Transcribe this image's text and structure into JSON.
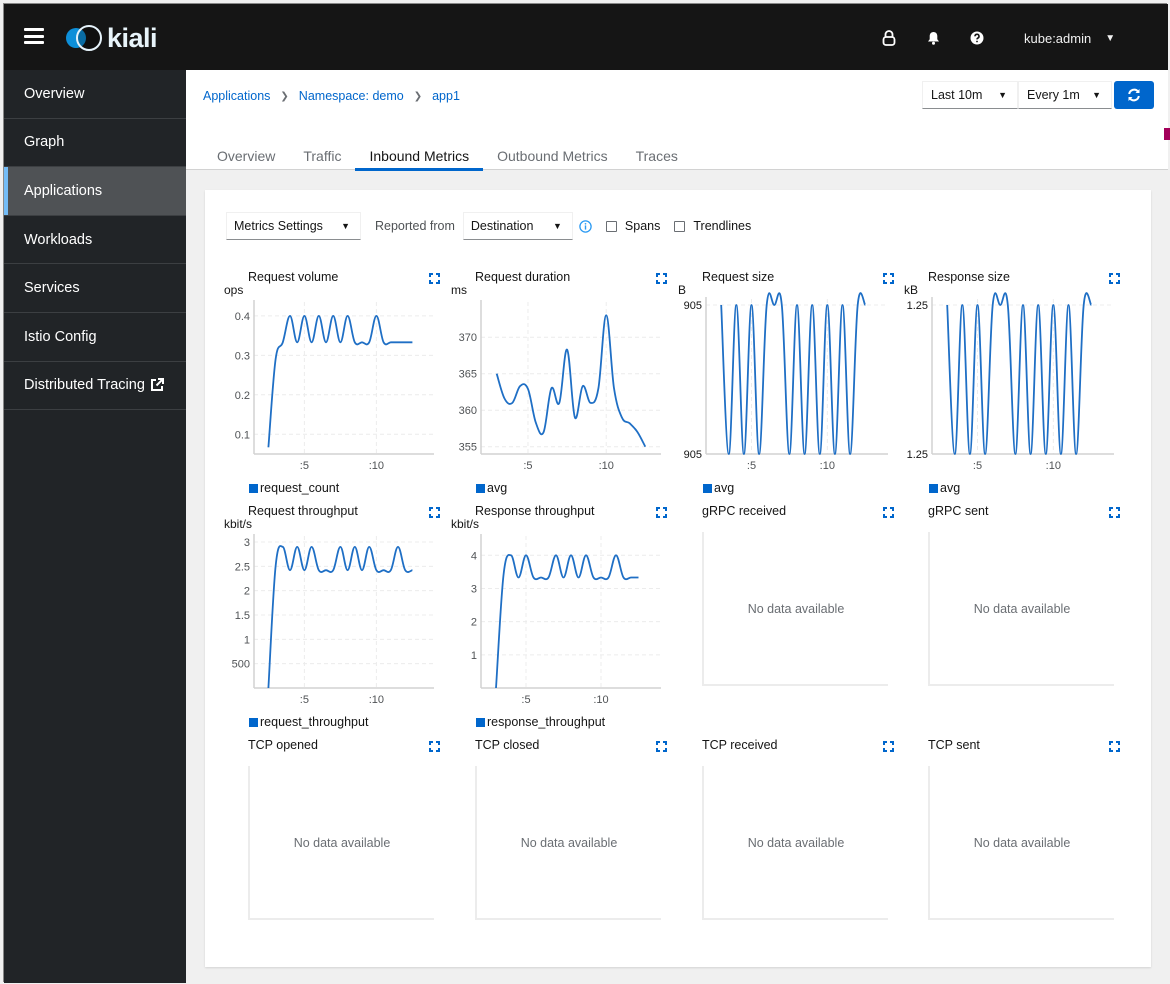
{
  "topbar": {
    "brand": "kiali",
    "icons": [
      "lock-icon",
      "bell-icon",
      "help-icon"
    ],
    "user": "kube:admin"
  },
  "sidebar": {
    "items": [
      {
        "label": "Overview",
        "active": false
      },
      {
        "label": "Graph",
        "active": false
      },
      {
        "label": "Applications",
        "active": true
      },
      {
        "label": "Workloads",
        "active": false
      },
      {
        "label": "Services",
        "active": false
      },
      {
        "label": "Istio Config",
        "active": false
      },
      {
        "label": "Distributed Tracing",
        "active": false,
        "external": true
      }
    ]
  },
  "breadcrumb": [
    "Applications",
    "Namespace: demo",
    "app1"
  ],
  "time_controls": {
    "range": "Last 10m",
    "refresh": "Every 1m"
  },
  "tabs": [
    {
      "label": "Overview",
      "active": false
    },
    {
      "label": "Traffic",
      "active": false
    },
    {
      "label": "Inbound Metrics",
      "active": true
    },
    {
      "label": "Outbound Metrics",
      "active": false
    },
    {
      "label": "Traces",
      "active": false
    }
  ],
  "toolbar": {
    "metrics_settings": "Metrics Settings",
    "reported_from_label": "Reported from",
    "reported_from_value": "Destination",
    "spans_label": "Spans",
    "spans_checked": false,
    "trendlines_label": "Trendlines",
    "trendlines_checked": false
  },
  "colors": {
    "accent": "#0066cc",
    "series": "#1f6fc5",
    "nav_active_bar": "#73bcf7",
    "topbar_bg": "#151515",
    "sidebar_bg": "#212427"
  },
  "no_data_text": "No data available",
  "chart_data": [
    {
      "type": "line",
      "title": "Request volume",
      "ylabel": "ops",
      "legend": [
        "request_count"
      ],
      "xtick_labels": [
        ":5",
        ":10"
      ],
      "xticks": [
        5,
        10
      ],
      "xlim": [
        1.5,
        14
      ],
      "yticks": [
        0.1,
        0.2,
        0.3,
        0.4
      ],
      "ytick_labels": [
        "0.1",
        "0.2",
        "0.3",
        "0.4"
      ],
      "ylim": [
        0.05,
        0.42
      ],
      "x": [
        2.5,
        3,
        3.5,
        4,
        4.5,
        5,
        5.5,
        6,
        6.5,
        7,
        7.5,
        8,
        8.5,
        9,
        9.5,
        10,
        10.5,
        11,
        11.5,
        12,
        12.5
      ],
      "values": [
        0.067,
        0.29,
        0.333,
        0.4,
        0.333,
        0.4,
        0.333,
        0.4,
        0.333,
        0.4,
        0.333,
        0.4,
        0.333,
        0.333,
        0.333,
        0.4,
        0.333,
        0.333,
        0.333,
        0.333,
        0.333
      ]
    },
    {
      "type": "line",
      "title": "Request duration",
      "ylabel": "ms",
      "legend": [
        "avg"
      ],
      "xtick_labels": [
        ":5",
        ":10"
      ],
      "xticks": [
        5,
        10
      ],
      "xlim": [
        2,
        13.5
      ],
      "yticks": [
        355,
        360,
        365,
        370
      ],
      "ytick_labels": [
        "355",
        "360",
        "365",
        "370"
      ],
      "ylim": [
        354,
        374
      ],
      "x": [
        3,
        3.5,
        4,
        4.5,
        5,
        5.5,
        6,
        6.5,
        7,
        7.5,
        8,
        8.5,
        9,
        9.5,
        10,
        10.5,
        11,
        11.5,
        12,
        12.5
      ],
      "values": [
        365,
        361.6,
        361,
        363.3,
        362.9,
        358.3,
        357,
        363,
        361,
        368.3,
        359,
        363.3,
        361,
        363,
        373,
        363,
        359,
        358.2,
        357,
        355
      ]
    },
    {
      "type": "line",
      "title": "Request size",
      "ylabel": "B",
      "legend": [
        "avg"
      ],
      "xtick_labels": [
        ":5",
        ":10"
      ],
      "xticks": [
        5,
        10
      ],
      "xlim": [
        2,
        14
      ],
      "yticks": [
        0,
        1
      ],
      "ytick_labels": [
        "905",
        "905"
      ],
      "ylim": [
        0,
        1
      ],
      "x": [
        3,
        3.5,
        4,
        4.5,
        5,
        5.5,
        6,
        6.5,
        7,
        7.5,
        8,
        8.5,
        9,
        9.5,
        10,
        10.5,
        11,
        11.5,
        12,
        12.5
      ],
      "values": [
        1,
        0,
        1,
        0,
        1,
        0,
        1,
        1,
        1,
        0,
        1,
        0,
        1,
        0,
        1,
        0,
        1,
        0,
        1,
        1
      ]
    },
    {
      "type": "line",
      "title": "Response size",
      "ylabel": "kB",
      "legend": [
        "avg"
      ],
      "xtick_labels": [
        ":5",
        ":10"
      ],
      "xticks": [
        5,
        10
      ],
      "xlim": [
        2,
        14
      ],
      "yticks": [
        0,
        1
      ],
      "ytick_labels": [
        "1.25",
        "1.25"
      ],
      "ylim": [
        0,
        1
      ],
      "x": [
        3,
        3.5,
        4,
        4.5,
        5,
        5.5,
        6,
        6.5,
        7,
        7.5,
        8,
        8.5,
        9,
        9.5,
        10,
        10.5,
        11,
        11.5,
        12,
        12.5
      ],
      "values": [
        1,
        0,
        1,
        0,
        1,
        0,
        1,
        1,
        1,
        0,
        1,
        0,
        1,
        0,
        1,
        0,
        1,
        0,
        1,
        1
      ]
    },
    {
      "type": "line",
      "title": "Request throughput",
      "ylabel": "kbit/s",
      "legend": [
        "request_throughput"
      ],
      "xtick_labels": [
        ":5",
        ":10"
      ],
      "xticks": [
        5,
        10
      ],
      "xlim": [
        1.5,
        14
      ],
      "yticks": [
        0.5,
        1,
        1.5,
        2,
        2.5,
        3
      ],
      "ytick_labels": [
        "500",
        "1",
        "1.5",
        "2",
        "2.5",
        "3"
      ],
      "ylim": [
        0,
        3
      ],
      "x": [
        2.5,
        3,
        3.5,
        4,
        4.5,
        5,
        5.5,
        6,
        6.5,
        7,
        7.5,
        8,
        8.5,
        9,
        9.5,
        10,
        10.5,
        11,
        11.5,
        12,
        12.5
      ],
      "values": [
        0,
        2.5,
        2.9,
        2.42,
        2.9,
        2.42,
        2.9,
        2.42,
        2.42,
        2.42,
        2.9,
        2.42,
        2.9,
        2.42,
        2.9,
        2.42,
        2.42,
        2.42,
        2.9,
        2.42,
        2.42
      ]
    },
    {
      "type": "line",
      "title": "Response throughput",
      "ylabel": "kbit/s",
      "legend": [
        "response_throughput"
      ],
      "xtick_labels": [
        ":5",
        ":10"
      ],
      "xticks": [
        5,
        10
      ],
      "xlim": [
        2,
        14
      ],
      "yticks": [
        1,
        2,
        3,
        4
      ],
      "ytick_labels": [
        "1",
        "2",
        "3",
        "4"
      ],
      "ylim": [
        0,
        4.4
      ],
      "x": [
        3,
        3.5,
        4,
        4.5,
        5,
        5.5,
        6,
        6.5,
        7,
        7.5,
        8,
        8.5,
        9,
        9.5,
        10,
        10.5,
        11,
        11.5,
        12,
        12.5
      ],
      "values": [
        0,
        3.4,
        4,
        3.33,
        4,
        3.33,
        3.33,
        3.33,
        4,
        3.33,
        4,
        3.33,
        4,
        3.33,
        3.33,
        3.33,
        4,
        3.33,
        3.33,
        3.33
      ]
    },
    {
      "type": "line",
      "title": "gRPC received",
      "no_data": true
    },
    {
      "type": "line",
      "title": "gRPC sent",
      "no_data": true
    },
    {
      "type": "line",
      "title": "TCP opened",
      "no_data": true
    },
    {
      "type": "line",
      "title": "TCP closed",
      "no_data": true
    },
    {
      "type": "line",
      "title": "TCP received",
      "no_data": true
    },
    {
      "type": "line",
      "title": "TCP sent",
      "no_data": true
    }
  ]
}
